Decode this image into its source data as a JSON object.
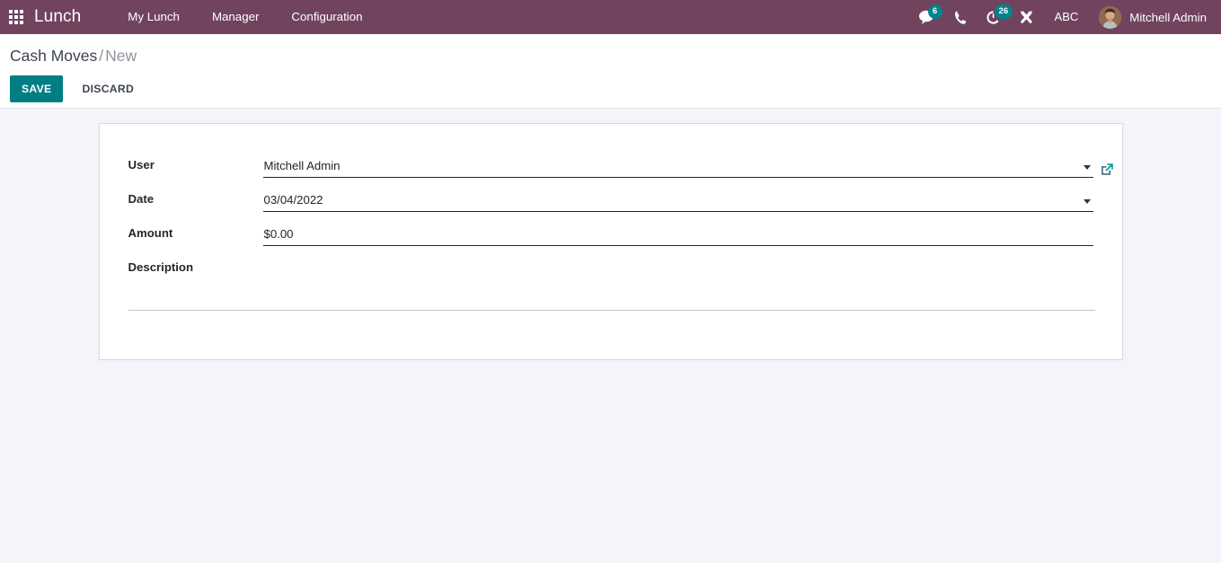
{
  "navbar": {
    "apps_icon": "apps-grid-icon",
    "brand": "Lunch",
    "menu": [
      {
        "label": "My Lunch"
      },
      {
        "label": "Manager"
      },
      {
        "label": "Configuration"
      }
    ],
    "right_icons": [
      {
        "name": "messages-icon",
        "badge": "6"
      },
      {
        "name": "phone-icon",
        "badge": ""
      },
      {
        "name": "activities-clock-icon",
        "badge": "26"
      },
      {
        "name": "developer-tools-icon",
        "badge": ""
      }
    ],
    "abc_label": "ABC",
    "user_name": "Mitchell Admin",
    "badge_color": "#00848b",
    "bar_color": "#71435f"
  },
  "control_panel": {
    "breadcrumb_root": "Cash Moves",
    "breadcrumb_separator": "/",
    "breadcrumb_current": "New",
    "save_label": "SAVE",
    "discard_label": "DISCARD",
    "save_color": "#017e84"
  },
  "form": {
    "fields": [
      {
        "label": "User",
        "value": "Mitchell Admin",
        "has_caret": true,
        "has_external_link": true
      },
      {
        "label": "Date",
        "value": "03/04/2022",
        "has_caret": true,
        "has_external_link": false
      },
      {
        "label": "Amount",
        "value": "$0.00",
        "has_caret": false,
        "has_external_link": false
      }
    ],
    "description_label": "Description",
    "description_value": ""
  }
}
